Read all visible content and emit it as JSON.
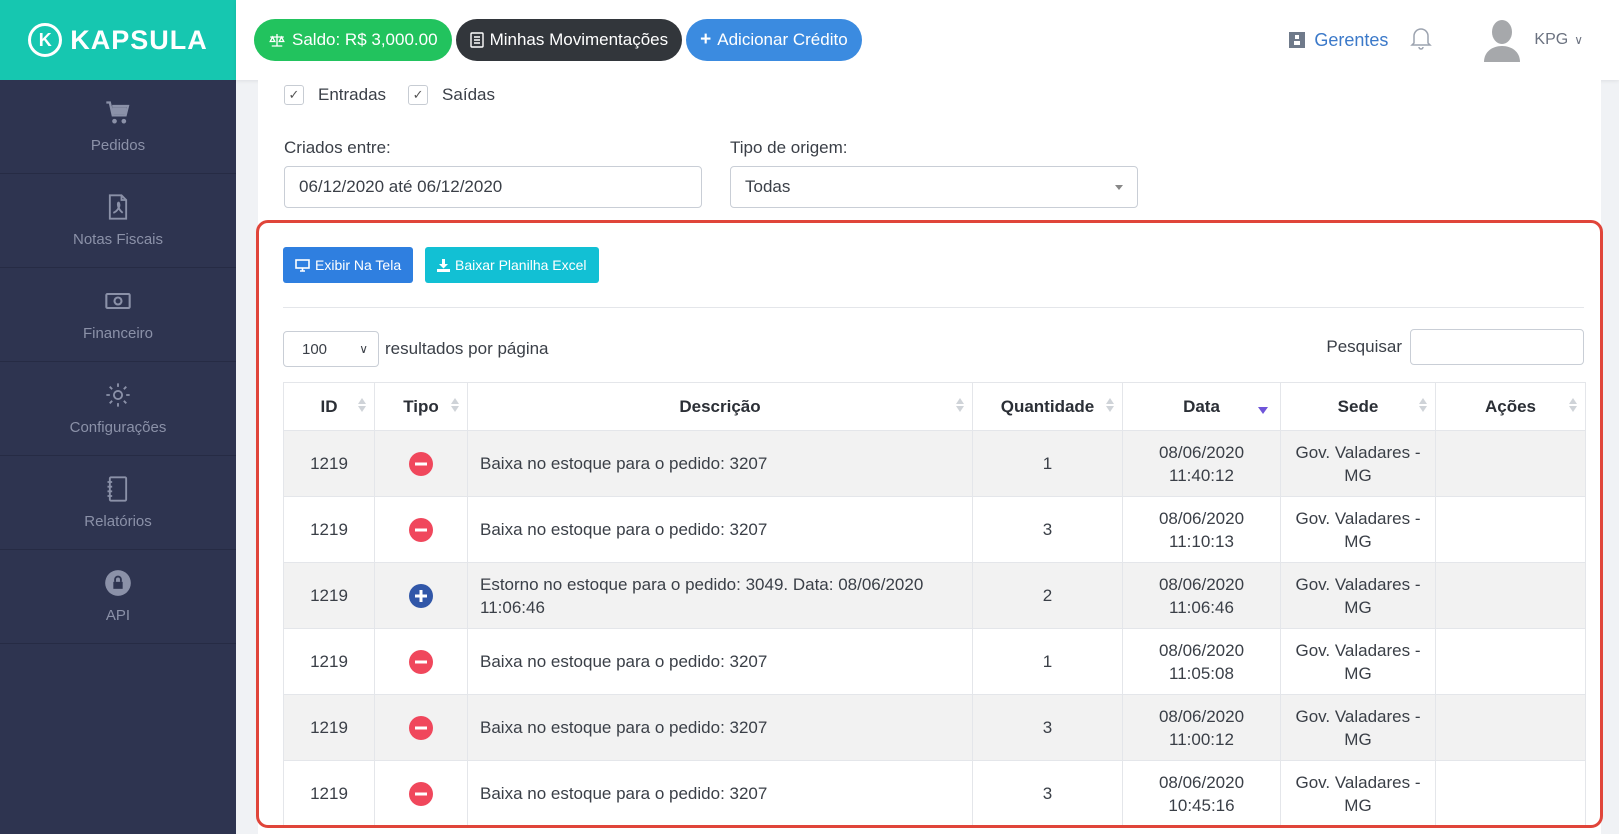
{
  "brand": {
    "name": "KAPSULA",
    "mark": "K"
  },
  "sidebar": {
    "items": [
      {
        "label": "Pedidos",
        "icon": "cart-icon"
      },
      {
        "label": "Notas Fiscais",
        "icon": "pdf-file-icon"
      },
      {
        "label": "Financeiro",
        "icon": "money-icon"
      },
      {
        "label": "Configurações",
        "icon": "gear-icon"
      },
      {
        "label": "Relatórios",
        "icon": "notebook-icon"
      },
      {
        "label": "API",
        "icon": "lock-icon"
      }
    ]
  },
  "topbar": {
    "saldo": "Saldo: R$ 3,000.00",
    "movimentacoes": "Minhas Movimentações",
    "adicionar": "Adicionar Crédito",
    "gerentes": "Gerentes",
    "user": "KPG"
  },
  "filters": {
    "entradas": "Entradas",
    "saidas": "Saídas",
    "criados_label": "Criados entre:",
    "criados_value": "06/12/2020 até 06/12/2020",
    "origem_label": "Tipo de origem:",
    "origem_value": "Todas"
  },
  "actions": {
    "exibir": "Exibir Na Tela",
    "baixar": "Baixar Planilha Excel"
  },
  "table_controls": {
    "perpage_value": "100",
    "perpage_label": "resultados por página",
    "search_label": "Pesquisar"
  },
  "table": {
    "headers": {
      "id": "ID",
      "tipo": "Tipo",
      "descricao": "Descrição",
      "quantidade": "Quantidade",
      "data": "Data",
      "sede": "Sede",
      "acoes": "Ações"
    },
    "rows": [
      {
        "id": "1219",
        "tipo": "saida",
        "descricao": "Baixa no estoque para o pedido: 3207",
        "quantidade": "1",
        "data_date": "08/06/2020",
        "data_time": "11:40:12",
        "sede_1": "Gov. Valadares -",
        "sede_2": "MG"
      },
      {
        "id": "1219",
        "tipo": "saida",
        "descricao": "Baixa no estoque para o pedido: 3207",
        "quantidade": "3",
        "data_date": "08/06/2020",
        "data_time": "11:10:13",
        "sede_1": "Gov. Valadares -",
        "sede_2": "MG"
      },
      {
        "id": "1219",
        "tipo": "entrada",
        "descricao": "Estorno no estoque para o pedido: 3049. Data: 08/06/2020 11:06:46",
        "quantidade": "2",
        "data_date": "08/06/2020",
        "data_time": "11:06:46",
        "sede_1": "Gov. Valadares -",
        "sede_2": "MG"
      },
      {
        "id": "1219",
        "tipo": "saida",
        "descricao": "Baixa no estoque para o pedido: 3207",
        "quantidade": "1",
        "data_date": "08/06/2020",
        "data_time": "11:05:08",
        "sede_1": "Gov. Valadares -",
        "sede_2": "MG"
      },
      {
        "id": "1219",
        "tipo": "saida",
        "descricao": "Baixa no estoque para o pedido: 3207",
        "quantidade": "3",
        "data_date": "08/06/2020",
        "data_time": "11:00:12",
        "sede_1": "Gov. Valadares -",
        "sede_2": "MG"
      },
      {
        "id": "1219",
        "tipo": "saida",
        "descricao": "Baixa no estoque para o pedido: 3207",
        "quantidade": "3",
        "data_date": "08/06/2020",
        "data_time": "10:45:16",
        "sede_1": "Gov. Valadares -",
        "sede_2": "MG"
      }
    ]
  },
  "colors": {
    "brand": "#16c7b0",
    "sidebar": "#2e3450",
    "highlight": "#e0453a",
    "minus": "#f0475c",
    "plus": "#3157a8"
  }
}
